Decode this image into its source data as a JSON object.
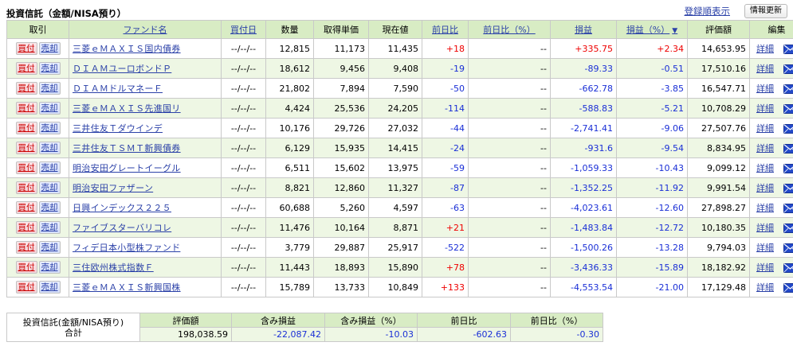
{
  "header": {
    "title": "投資信託（金額/NISA預り）",
    "reg_order_link": "登録順表示",
    "refresh_button": "情報更新"
  },
  "columns": {
    "trade": "取引",
    "fund_name": "ファンド名",
    "buy_date": "買付日",
    "quantity": "数量",
    "acq_price": "取得単価",
    "current_price": "現在値",
    "day_change": "前日比",
    "day_change_pct": "前日比（%）",
    "profit": "損益",
    "profit_pct": "損益（%）",
    "valuation": "評価額",
    "edit": "編集"
  },
  "labels": {
    "buy": "買付",
    "sell": "売却",
    "detail": "詳細"
  },
  "icons": {
    "sort": "sort-down-icon",
    "mail": "mail-icon"
  },
  "colors": {
    "header_bg": "#d8ecc4",
    "row_alt_bg": "#eef7e4",
    "positive": "#ee0000",
    "negative": "#1a2fd6",
    "link": "#2b41a8"
  },
  "rows": [
    {
      "name": "三菱ｅＭＡＸＩＳ国内債券",
      "date": "--/--/--",
      "qty": "12,815",
      "acq": "11,173",
      "cur": "11,435",
      "chg": "+18",
      "chg_pct": "--",
      "pl": "+335.75",
      "pl_pct": "+2.34",
      "val": "14,653.95"
    },
    {
      "name": "ＤＩＡＭユーロボンドＰ",
      "date": "--/--/--",
      "qty": "18,612",
      "acq": "9,456",
      "cur": "9,408",
      "chg": "-19",
      "chg_pct": "--",
      "pl": "-89.33",
      "pl_pct": "-0.51",
      "val": "17,510.16"
    },
    {
      "name": "ＤＩＡＭドルマネーＦ",
      "date": "--/--/--",
      "qty": "21,802",
      "acq": "7,894",
      "cur": "7,590",
      "chg": "-50",
      "chg_pct": "--",
      "pl": "-662.78",
      "pl_pct": "-3.85",
      "val": "16,547.71"
    },
    {
      "name": "三菱ｅＭＡＸＩＳ先進国リ",
      "date": "--/--/--",
      "qty": "4,424",
      "acq": "25,536",
      "cur": "24,205",
      "chg": "-114",
      "chg_pct": "--",
      "pl": "-588.83",
      "pl_pct": "-5.21",
      "val": "10,708.29"
    },
    {
      "name": "三井住友Ｔダウインデ",
      "date": "--/--/--",
      "qty": "10,176",
      "acq": "29,726",
      "cur": "27,032",
      "chg": "-44",
      "chg_pct": "--",
      "pl": "-2,741.41",
      "pl_pct": "-9.06",
      "val": "27,507.76"
    },
    {
      "name": "三井住友ＴＳＭＴ新興債券",
      "date": "--/--/--",
      "qty": "6,129",
      "acq": "15,935",
      "cur": "14,415",
      "chg": "-24",
      "chg_pct": "--",
      "pl": "-931.6",
      "pl_pct": "-9.54",
      "val": "8,834.95"
    },
    {
      "name": "明治安田グレートイーグル",
      "date": "--/--/--",
      "qty": "6,511",
      "acq": "15,602",
      "cur": "13,975",
      "chg": "-59",
      "chg_pct": "--",
      "pl": "-1,059.33",
      "pl_pct": "-10.43",
      "val": "9,099.12"
    },
    {
      "name": "明治安田ファザーン",
      "date": "--/--/--",
      "qty": "8,821",
      "acq": "12,860",
      "cur": "11,327",
      "chg": "-87",
      "chg_pct": "--",
      "pl": "-1,352.25",
      "pl_pct": "-11.92",
      "val": "9,991.54"
    },
    {
      "name": "日興インデックス２２５",
      "date": "--/--/--",
      "qty": "60,688",
      "acq": "5,260",
      "cur": "4,597",
      "chg": "-63",
      "chg_pct": "--",
      "pl": "-4,023.61",
      "pl_pct": "-12.60",
      "val": "27,898.27"
    },
    {
      "name": "ファイブスターバリコレ",
      "date": "--/--/--",
      "qty": "11,476",
      "acq": "10,164",
      "cur": "8,871",
      "chg": "+21",
      "chg_pct": "--",
      "pl": "-1,483.84",
      "pl_pct": "-12.72",
      "val": "10,180.35"
    },
    {
      "name": "フィデ日本小型株ファンド",
      "date": "--/--/--",
      "qty": "3,779",
      "acq": "29,887",
      "cur": "25,917",
      "chg": "-522",
      "chg_pct": "--",
      "pl": "-1,500.26",
      "pl_pct": "-13.28",
      "val": "9,794.03"
    },
    {
      "name": "三住欧州株式指数Ｆ",
      "date": "--/--/--",
      "qty": "11,443",
      "acq": "18,893",
      "cur": "15,890",
      "chg": "+78",
      "chg_pct": "--",
      "pl": "-3,436.33",
      "pl_pct": "-15.89",
      "val": "18,182.92"
    },
    {
      "name": "三菱ｅＭＡＸＩＳ新興国株",
      "date": "--/--/--",
      "qty": "15,789",
      "acq": "13,733",
      "cur": "10,849",
      "chg": "+133",
      "chg_pct": "--",
      "pl": "-4,553.54",
      "pl_pct": "-21.00",
      "val": "17,129.48"
    }
  ],
  "summary": {
    "label_line1": "投資信託(金額/NISA預り)",
    "label_line2": "合計",
    "headers": {
      "valuation": "評価額",
      "unrealized": "含み損益",
      "unrealized_pct": "含み損益（%）",
      "day_change": "前日比",
      "day_change_pct": "前日比（%）"
    },
    "values": {
      "valuation": "198,038.59",
      "unrealized": "-22,087.42",
      "unrealized_pct": "-10.03",
      "day_change": "-602.63",
      "day_change_pct": "-0.30"
    }
  }
}
